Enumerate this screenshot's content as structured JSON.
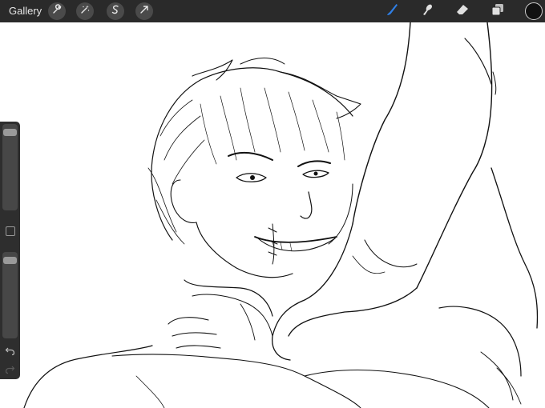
{
  "app": {
    "gallery_label": "Gallery"
  },
  "toolbar": {
    "left_tools": [
      "wrench-icon",
      "magic-wand-icon",
      "selection-icon",
      "transform-arrow-icon"
    ],
    "right_tools": [
      "brush-icon",
      "smudge-icon",
      "eraser-icon",
      "layers-icon"
    ],
    "active_tool": "brush-icon",
    "active_color": "#2f7fe6",
    "current_color": "#111111"
  },
  "sidebar": {
    "brush_size_level": 0.05,
    "opacity_level": 0.05,
    "buttons": [
      "modify-square-icon",
      "undo-icon",
      "redo-icon"
    ]
  },
  "colors": {
    "bar_background": "#2a2a2a",
    "canvas": "#ffffff",
    "line_art": "#111111"
  }
}
